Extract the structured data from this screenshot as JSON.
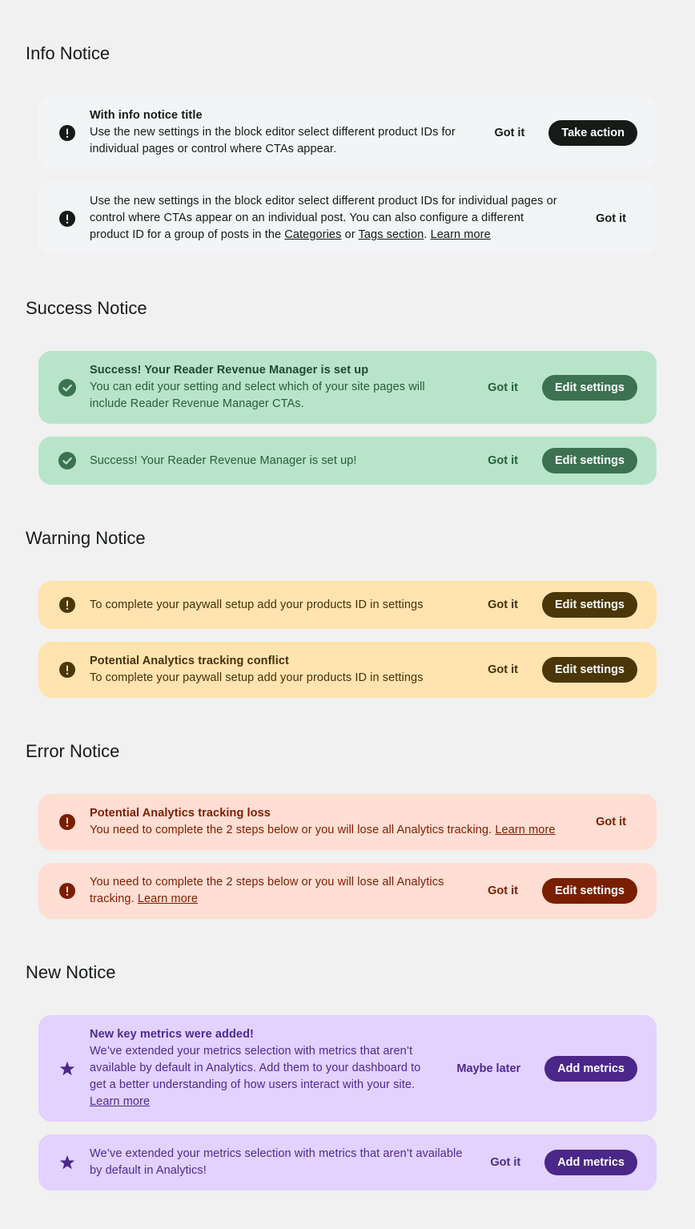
{
  "sections": {
    "info": {
      "title": "Info Notice"
    },
    "success": {
      "title": "Success Notice"
    },
    "warning": {
      "title": "Warning Notice"
    },
    "error": {
      "title": "Error Notice"
    },
    "new": {
      "title": "New Notice"
    }
  },
  "notices": {
    "info_1": {
      "title": "With info notice title",
      "description": "Use the new settings in the block editor select different product IDs for individual pages or control where CTAs appear.",
      "dismiss_label": "Got it",
      "cta_label": "Take action",
      "icon": "exclamation-circle-icon"
    },
    "info_2": {
      "description_before": "Use the new settings in the block editor select different product IDs for individual pages or control where CTAs appear on an individual post. You can also configure a different product ID for a group of posts in the ",
      "link_categories": "Categories",
      "description_or": " or ",
      "link_tags": "Tags section",
      "description_period": ". ",
      "learn_more": "Learn more",
      "dismiss_label": "Got it",
      "icon": "exclamation-circle-icon"
    },
    "success_1": {
      "title": "Success! Your Reader Revenue Manager is set up",
      "description": "You can edit your setting and select which of your site pages will include Reader Revenue Manager CTAs.",
      "dismiss_label": "Got it",
      "cta_label": "Edit settings",
      "icon": "check-circle-icon"
    },
    "success_2": {
      "description": "Success! Your Reader Revenue Manager is set up!",
      "dismiss_label": "Got it",
      "cta_label": "Edit settings",
      "icon": "check-circle-icon"
    },
    "warning_1": {
      "description": "To complete your paywall setup add your products ID in settings",
      "dismiss_label": "Got it",
      "cta_label": "Edit settings",
      "icon": "exclamation-circle-icon"
    },
    "warning_2": {
      "title": "Potential Analytics tracking conflict",
      "description": "To complete your paywall setup add your products ID in settings",
      "dismiss_label": "Got it",
      "cta_label": "Edit settings",
      "icon": "exclamation-circle-icon"
    },
    "error_1": {
      "title": "Potential Analytics tracking loss",
      "description": "You need to complete the 2 steps below or you will lose all Analytics tracking. ",
      "learn_more": "Learn more",
      "dismiss_label": "Got it",
      "icon": "exclamation-circle-icon"
    },
    "error_2": {
      "description": "You need to complete the 2 steps below or you will lose all Analytics tracking. ",
      "learn_more": "Learn more",
      "dismiss_label": "Got it",
      "cta_label": "Edit settings",
      "icon": "exclamation-circle-icon"
    },
    "new_1": {
      "title": "New key metrics were added!",
      "description": "We’ve extended your metrics selection with metrics that aren’t available by default in Analytics. Add them to your dashboard to get a better understanding of how users interact with your site. ",
      "learn_more": "Learn more",
      "dismiss_label": "Maybe later",
      "cta_label": "Add metrics",
      "icon": "star-icon"
    },
    "new_2": {
      "description": "We’ve extended your metrics selection with metrics that aren’t available by default in Analytics!",
      "dismiss_label": "Got it",
      "cta_label": "Add metrics",
      "icon": "star-icon"
    }
  },
  "colors": {
    "page_background": "#f1f1f1",
    "info_background": "#f3f4f6",
    "success_background": "#b8e5ca",
    "warning_background": "#ffe4b0",
    "error_background": "#ffded3",
    "new_background": "#e3d1ff"
  }
}
